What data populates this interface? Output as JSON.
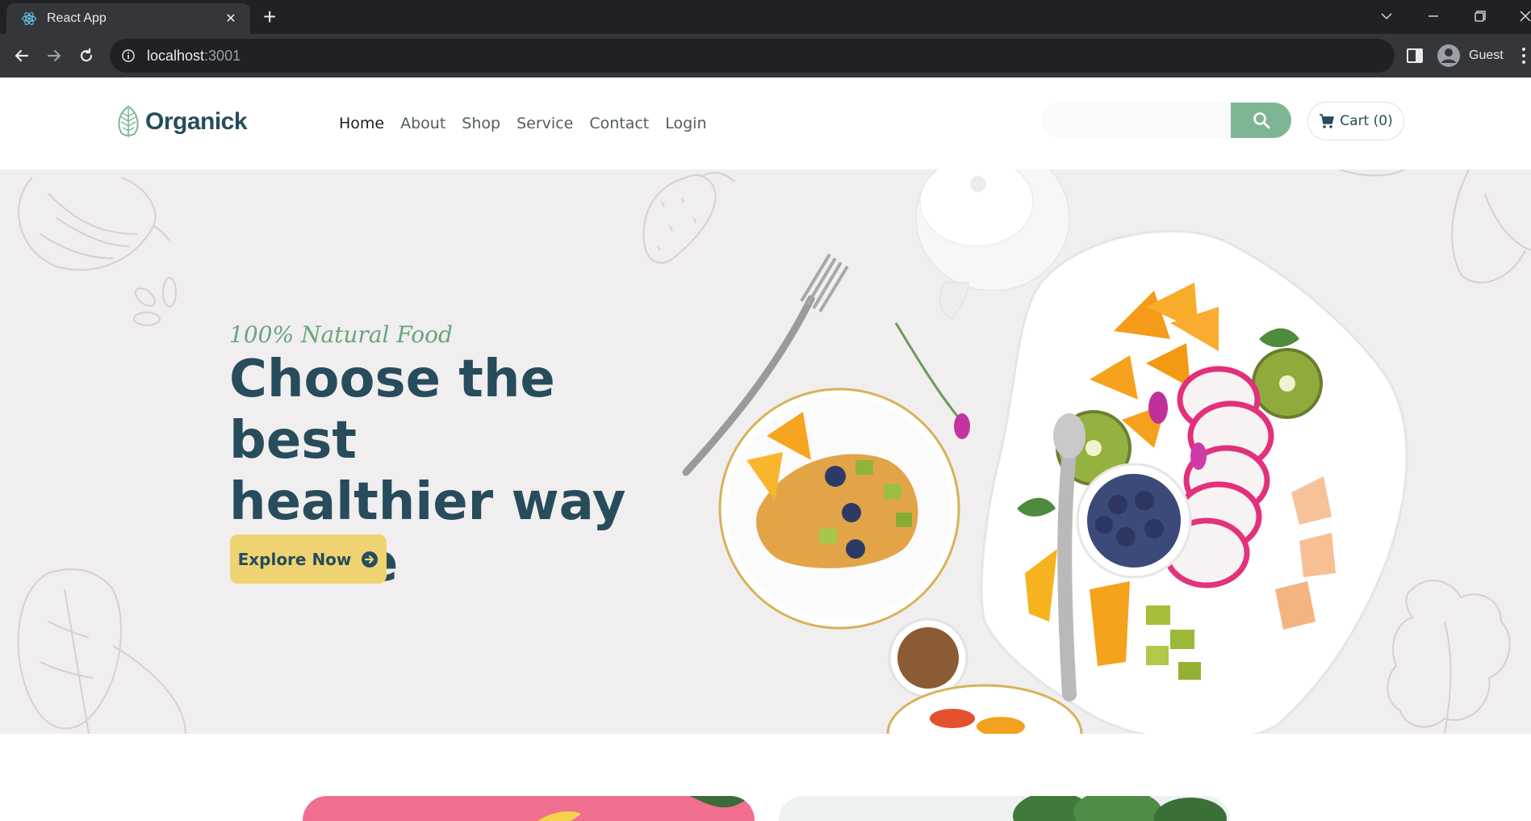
{
  "browser": {
    "tab_title": "React App",
    "url_host": "localhost",
    "url_port": ":3001",
    "profile_name": "Guest"
  },
  "site": {
    "brand": "Organick",
    "nav": [
      {
        "label": "Home",
        "active": true
      },
      {
        "label": "About"
      },
      {
        "label": "Shop"
      },
      {
        "label": "Service"
      },
      {
        "label": "Contact"
      },
      {
        "label": "Login"
      }
    ],
    "search_placeholder": "",
    "cart_label": "Cart (0)"
  },
  "hero": {
    "tagline": "100% Natural Food",
    "headline_lines": [
      "Choose the best",
      "healthier way",
      "of life"
    ],
    "cta_label": "Explore Now"
  },
  "colors": {
    "brand_dark": "#274c5b",
    "brand_green": "#7eb693",
    "accent_yellow": "#efd372",
    "hero_bg": "#f1eeef"
  }
}
